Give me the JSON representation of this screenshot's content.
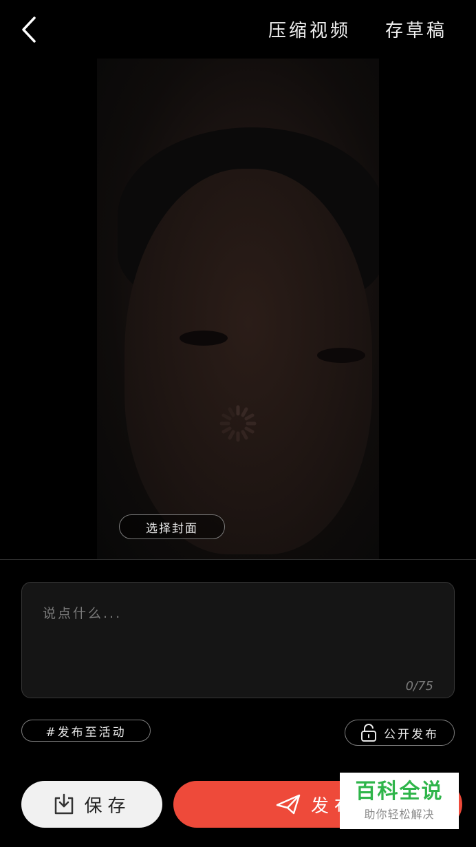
{
  "header": {
    "compress_label": "压缩视频",
    "draft_label": "存草稿"
  },
  "preview": {
    "cover_label": "选择封面"
  },
  "caption": {
    "placeholder": "说点什么...",
    "count": "0/75"
  },
  "options": {
    "activity_label": "#发布至活动",
    "visibility_label": "公开发布"
  },
  "actions": {
    "save_label": "保存",
    "publish_label": "发布"
  },
  "watermark": {
    "title": "百科全说",
    "subtitle": "助你轻松解决"
  },
  "colors": {
    "background": "#000000",
    "publish": "#ee4a3a",
    "save": "#f1f1f1",
    "watermark_green": "#2fb54a"
  }
}
